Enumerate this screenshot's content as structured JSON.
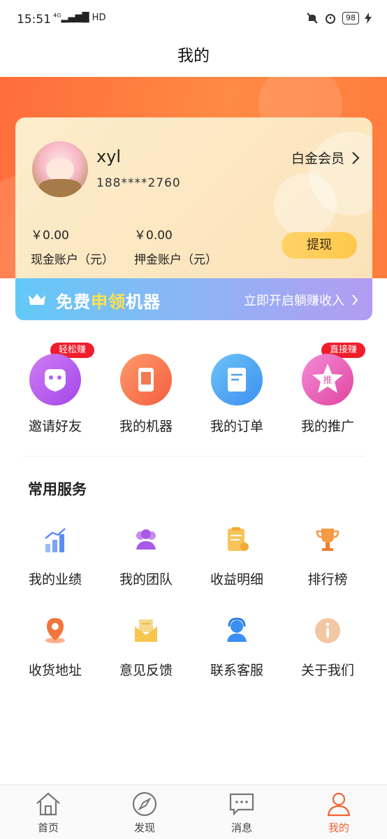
{
  "status": {
    "time": "15:51",
    "network": "⁴ᴳ▂▄▆█ HD",
    "battery": "98"
  },
  "header": {
    "title": "我的"
  },
  "profile": {
    "name": "xyl",
    "phone": "188****2760",
    "level": "白金会员"
  },
  "accounts": [
    {
      "amount": "￥0.00",
      "label": "现金账户（元）"
    },
    {
      "amount": "￥0.00",
      "label": "押金账户（元）"
    }
  ],
  "withdraw_label": "提现",
  "promo": {
    "title_a": "免费",
    "title_b": "申领",
    "title_c": "机器",
    "cta": "立即开启躺赚收入"
  },
  "quick_actions": [
    {
      "label": "邀请好友",
      "tag": "轻松赚",
      "icon": "invite-icon"
    },
    {
      "label": "我的机器",
      "icon": "machine-icon"
    },
    {
      "label": "我的订单",
      "icon": "order-icon"
    },
    {
      "label": "我的推广",
      "tag": "直接赚",
      "icon": "promote-icon",
      "badge": "推"
    }
  ],
  "services_title": "常用服务",
  "services": [
    {
      "label": "我的业绩",
      "icon": "bar-chart-icon"
    },
    {
      "label": "我的团队",
      "icon": "team-icon"
    },
    {
      "label": "收益明细",
      "icon": "ledger-icon"
    },
    {
      "label": "排行榜",
      "icon": "trophy-icon"
    },
    {
      "label": "收货地址",
      "icon": "location-pin-icon"
    },
    {
      "label": "意见反馈",
      "icon": "envelope-icon"
    },
    {
      "label": "联系客服",
      "icon": "customer-service-icon"
    },
    {
      "label": "关于我们",
      "icon": "info-icon"
    }
  ],
  "tabs": [
    {
      "label": "首页",
      "icon": "home-icon"
    },
    {
      "label": "发现",
      "icon": "compass-icon"
    },
    {
      "label": "消息",
      "icon": "message-icon"
    },
    {
      "label": "我的",
      "icon": "profile-icon",
      "active": true
    }
  ],
  "colors": {
    "accent": "#F06433",
    "tag_red": "#F01D2C",
    "card_bg": "#FCE7C2",
    "button_yellow": "#FFC84A"
  }
}
